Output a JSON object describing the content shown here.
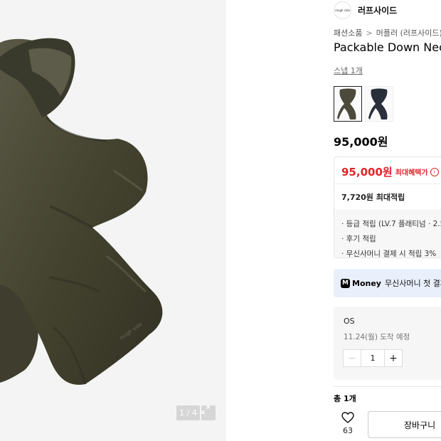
{
  "gallery": {
    "counter": "1 / 4",
    "product_watermark": "rough side"
  },
  "brand": {
    "logo_text": "rough side",
    "name": "러프사이드"
  },
  "breadcrumb": {
    "category": "패션소품",
    "separator": ">",
    "subcategory": "머플러 (러프사이드)"
  },
  "product": {
    "title": "Packable Down Neck",
    "snap_link": "스냅 1개",
    "price": "95,000원",
    "swatches": [
      {
        "name": "khaki",
        "color": "#4c4a3b"
      },
      {
        "name": "navy",
        "color": "#2a2f3c"
      }
    ]
  },
  "benefit": {
    "price": "95,000원",
    "label": "최대혜택가",
    "info_glyph": "i",
    "points_title": "7,720원 최대적립",
    "points": [
      "· 등급 적립 (LV.7 플래티넘 · 2.5",
      "· 후기 적립",
      "· 무신사머니 결제 시 적립 3%"
    ]
  },
  "money": {
    "icon_letter": "M",
    "label": "Money",
    "text": "무신사머니 첫 결제"
  },
  "option": {
    "name": "OS",
    "arrival": "11.24(월) 도착 예정",
    "quantity": "1",
    "minus": "−",
    "plus": "+"
  },
  "order": {
    "total": "총 1개",
    "like_count": "63",
    "cart_button": "장바구니"
  },
  "colors": {
    "accent_red": "#e0262a",
    "money_bg": "#e9effb",
    "product_khaki": "#4c4a3b"
  }
}
